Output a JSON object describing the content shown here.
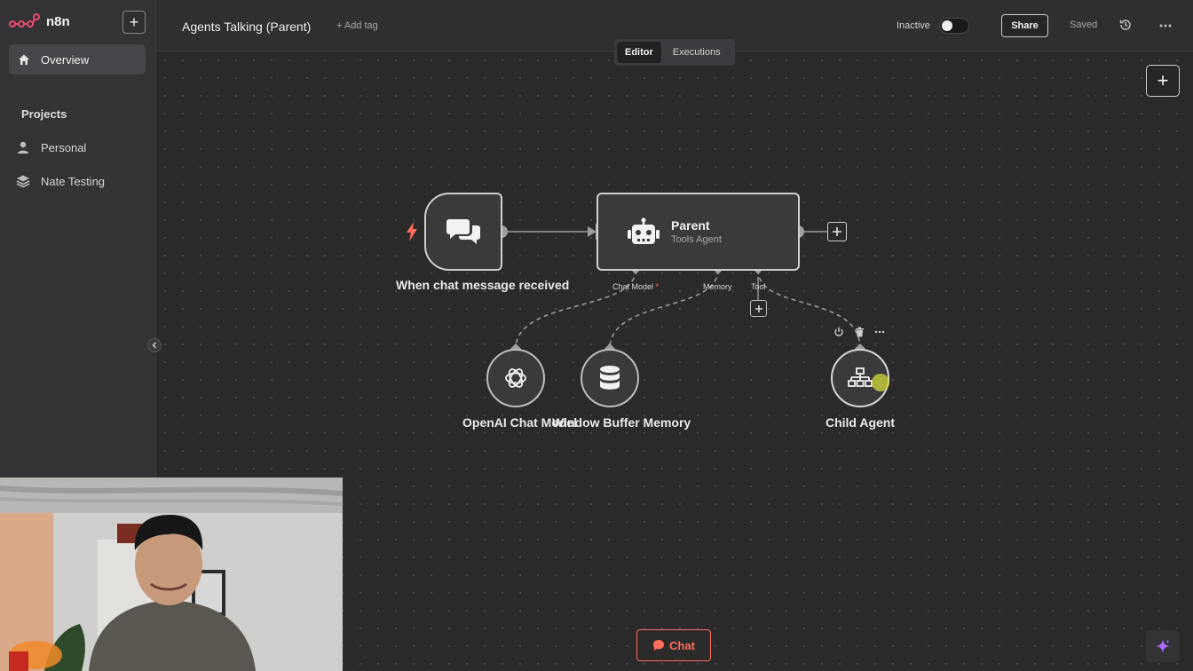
{
  "app": {
    "name": "n8n"
  },
  "sidebar": {
    "overview_label": "Overview",
    "projects_heading": "Projects",
    "projects": [
      {
        "label": "Personal",
        "icon": "user-icon"
      },
      {
        "label": "Nate Testing",
        "icon": "layers-icon"
      }
    ]
  },
  "header": {
    "title": "Agents Talking (Parent)",
    "add_tag": "+ Add tag",
    "status_label": "Inactive",
    "active": false,
    "share_label": "Share",
    "saved_label": "Saved"
  },
  "tabs": [
    {
      "label": "Editor",
      "active": true
    },
    {
      "label": "Executions",
      "active": false
    }
  ],
  "nodes": {
    "trigger": {
      "label": "When chat message received",
      "icon": "chat-bubbles-icon"
    },
    "agent": {
      "title": "Parent",
      "subtitle": "Tools Agent",
      "icon": "robot-icon"
    },
    "openai": {
      "label": "OpenAI Chat Model",
      "icon": "openai-icon"
    },
    "memory": {
      "label": "Window Buffer Memory",
      "icon": "database-icon"
    },
    "child": {
      "label": "Child Agent",
      "icon": "sitemap-icon"
    }
  },
  "ports": {
    "chat_model": "Chat Model",
    "chat_model_required": "*",
    "memory": "Memory",
    "tool": "Tool"
  },
  "chat_button": {
    "label": "Chat"
  },
  "colors": {
    "accent": "#ff6d5a",
    "canvas": "#2a2a2b",
    "sidebar": "#333335",
    "ai_sparkle": "#b06bff"
  }
}
